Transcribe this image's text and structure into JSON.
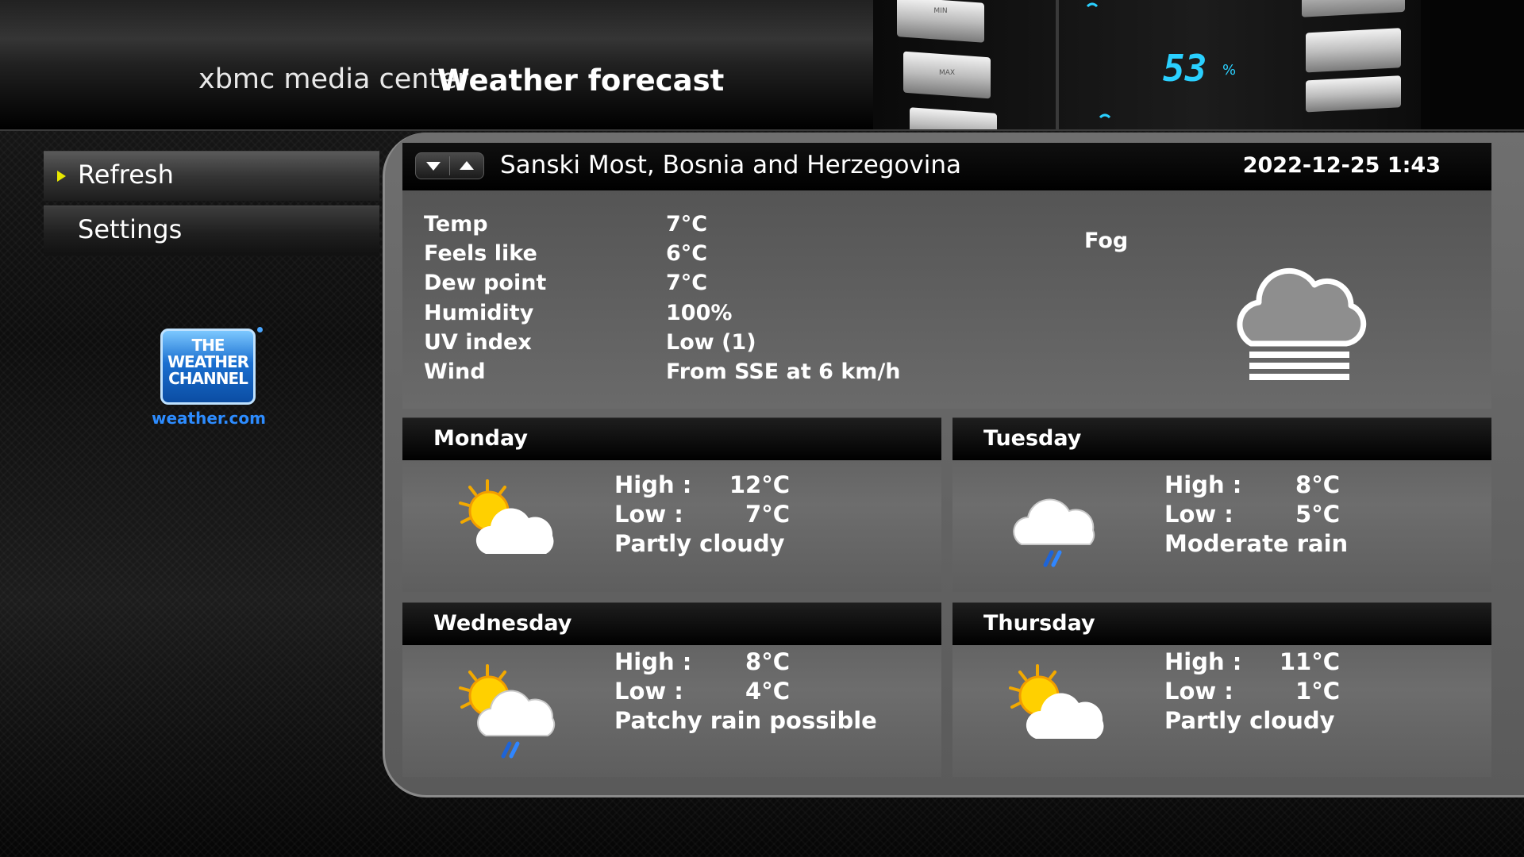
{
  "header": {
    "app_name": "xbmc media center",
    "title": "Weather forecast"
  },
  "sidebar": {
    "items": [
      {
        "label": "Refresh",
        "focused": true
      },
      {
        "label": "Settings",
        "focused": false
      }
    ],
    "logo": {
      "badge_text": "THE WEATHER CHANNEL",
      "site": "weather.com"
    }
  },
  "location": {
    "name": "Sanski Most, Bosnia and Herzegovina",
    "updated": "2022-12-25 1:43",
    "spin_icons": [
      "chevron-down-icon",
      "chevron-up-icon"
    ]
  },
  "current": {
    "condition": "Fog",
    "icon": "fog-icon",
    "rows": [
      {
        "label": "Temp",
        "value": "7°C"
      },
      {
        "label": "Feels like",
        "value": "6°C"
      },
      {
        "label": "Dew point",
        "value": "7°C"
      },
      {
        "label": "Humidity",
        "value": "100%"
      },
      {
        "label": "UV index",
        "value": "Low (1)"
      },
      {
        "label": "Wind",
        "value": "From SSE at 6 km/h"
      }
    ]
  },
  "forecast": {
    "high_label": "High :",
    "low_label": "Low :",
    "days": [
      {
        "day": "Monday",
        "high": "12°C",
        "low": "7°C",
        "condition": "Partly cloudy",
        "icon": "partly-cloudy-icon"
      },
      {
        "day": "Tuesday",
        "high": "8°C",
        "low": "5°C",
        "condition": "Moderate rain",
        "icon": "rain-cloud-icon"
      },
      {
        "day": "Wednesday",
        "high": "8°C",
        "low": "4°C",
        "condition": "Patchy rain possible",
        "icon": "patchy-rain-icon"
      },
      {
        "day": "Thursday",
        "high": "11°C",
        "low": "1°C",
        "condition": "Partly cloudy",
        "icon": "partly-cloudy-icon"
      }
    ]
  },
  "background_widget": {
    "readout": "53",
    "unit": "%",
    "buttons": [
      "MIN",
      "MAX"
    ]
  },
  "colors": {
    "accent_arrow": "#e8e800",
    "logo_blue": "#1a6fd0",
    "site_blue": "#2d8cff",
    "lcd_cyan": "#2ad0ff"
  }
}
